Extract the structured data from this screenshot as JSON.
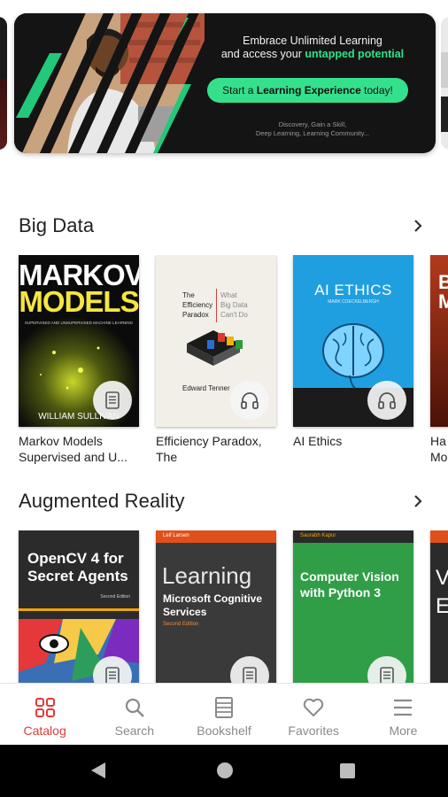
{
  "banner": {
    "line1": "Embrace Unlimited Learning",
    "line2_prefix": "and access your ",
    "line2_highlight": "untapped potential",
    "cta_prefix": "Start a ",
    "cta_bold": "Learning Experience",
    "cta_suffix": " today!",
    "small_line1": "Discovery, Gain a Skill,",
    "small_line2": "Deep Learning, Learning Community..."
  },
  "sections": [
    {
      "title": "Big Data",
      "books": [
        {
          "title_line1": "Markov Models",
          "title_line2": "Supervised and U...",
          "format": "ebook",
          "cover": {
            "line1": "MARKOV",
            "line2": "MODELS",
            "sub": "SUPERVISED AND UNSUPERVISED MACHINE LEARNING",
            "author": "WILLIAM SULLIVAN"
          }
        },
        {
          "title_line1": "Efficiency Paradox,",
          "title_line2": "The",
          "format": "audiobook",
          "cover": {
            "t1": "The",
            "t2": "Efficiency",
            "t3": "Paradox",
            "s1": "What",
            "s2": "Big Data",
            "s3": "Can't Do",
            "author": "Edward Tenner"
          }
        },
        {
          "title_line1": "AI Ethics",
          "title_line2": "",
          "format": "audiobook",
          "cover": {
            "title": "AI ETHICS",
            "author": "MARK COECKELBERGH"
          }
        },
        {
          "title_line1": "Ha",
          "title_line2": "Mo",
          "format": "ebook",
          "cover": {
            "l1": "B",
            "l2": "M"
          }
        }
      ]
    },
    {
      "title": "Augmented Reality",
      "books": [
        {
          "title_line1": "OpenCV 4 for Secret Agents",
          "title_line2": "",
          "format": "ebook",
          "cover": {
            "line1": "OpenCV 4 for",
            "line2": "Secret Agents",
            "edition": "Second Edition"
          }
        },
        {
          "title_line1": "Learning Microsoft Cognitive Services",
          "title_line2": "",
          "format": "ebook",
          "cover": {
            "author": "Leif Larsen",
            "line1": "Learning",
            "line2": "Microsoft Cognitive",
            "line3": "Services",
            "edition": "Second Edition"
          }
        },
        {
          "title_line1": "Computer Vision with Python 3",
          "title_line2": "",
          "format": "ebook",
          "cover": {
            "author": "Saurabh Kapur",
            "line1": "Computer Vision",
            "line2": "with Python 3"
          }
        },
        {
          "title_line1": "",
          "title_line2": "",
          "format": "ebook",
          "cover": {
            "l1": "V",
            "l2": "E"
          }
        }
      ]
    }
  ],
  "nav": [
    {
      "label": "Catalog",
      "icon": "catalog-grid-icon",
      "active": true
    },
    {
      "label": "Search",
      "icon": "search-icon",
      "active": false
    },
    {
      "label": "Bookshelf",
      "icon": "bookshelf-icon",
      "active": false
    },
    {
      "label": "Favorites",
      "icon": "heart-icon",
      "active": false
    },
    {
      "label": "More",
      "icon": "menu-icon",
      "active": false
    }
  ],
  "colors": {
    "accent": "#e53935",
    "banner_green": "#35e08c",
    "nav_inactive": "#8a8a8a"
  }
}
